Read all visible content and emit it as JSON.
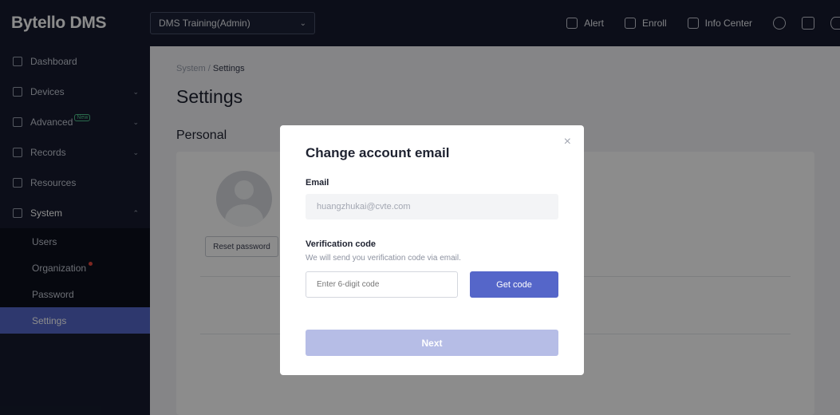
{
  "app": {
    "title": "Bytello DMS"
  },
  "header": {
    "org_select": "DMS Training(Admin)",
    "actions": [
      {
        "label": "Alert",
        "icon": "bell-icon"
      },
      {
        "label": "Enroll",
        "icon": "enroll-icon"
      },
      {
        "label": "Info Center",
        "icon": "mail-icon"
      }
    ]
  },
  "sidebar": {
    "items": [
      {
        "label": "Dashboard",
        "icon": "chart-icon"
      },
      {
        "label": "Devices",
        "icon": "monitor-icon"
      },
      {
        "label": "Advanced",
        "icon": "star-icon",
        "badge": "New"
      },
      {
        "label": "Records",
        "icon": "records-icon"
      },
      {
        "label": "Resources",
        "icon": "cloud-icon"
      },
      {
        "label": "System",
        "icon": "sliders-icon"
      }
    ],
    "sub_items": [
      {
        "label": "Users"
      },
      {
        "label": "Organization"
      },
      {
        "label": "Password"
      },
      {
        "label": "Settings"
      }
    ]
  },
  "page": {
    "breadcrumb_parent": "System",
    "breadcrumb_sep": "/",
    "breadcrumb_current": "Settings",
    "title": "Settings",
    "section": "Personal",
    "reset_password": "Reset password"
  },
  "modal": {
    "title": "Change account email",
    "close": "×",
    "email_label": "Email",
    "email_value": "huangzhukai@cvte.com",
    "code_label": "Verification code",
    "code_hint": "We will send you verification code via email.",
    "code_placeholder": "Enter 6-digit code",
    "get_code": "Get code",
    "next": "Next"
  },
  "colors": {
    "accent": "#5566c9",
    "accent_disabled": "#b6bde6",
    "sidebar_bg": "#161b2e",
    "new_badge": "#4ec28a",
    "notification_dot": "#e5483c"
  }
}
